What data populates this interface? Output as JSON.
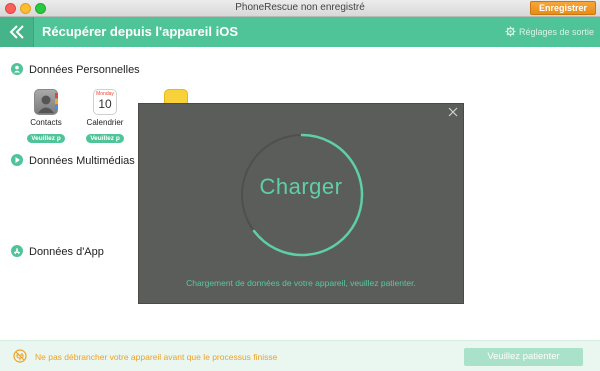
{
  "window": {
    "title": "PhoneRescue non enregistré",
    "register_label": "Enregistrer"
  },
  "header": {
    "title": "Récupérer depuis l'appareil iOS",
    "exit_settings_label": "Réglages de sortie"
  },
  "sections": {
    "personal": "Données Personnelles",
    "media": "Données Multimédias",
    "apps": "Données d'App"
  },
  "items": [
    {
      "label": "Contacts",
      "status": "Veuillez p",
      "icon": "contacts-icon"
    },
    {
      "label": "Calendrier",
      "status": "Veuillez p",
      "icon": "calendar-icon",
      "month": "Monday",
      "day": "10"
    },
    {
      "label": "",
      "status": "",
      "icon": "notes-icon"
    }
  ],
  "modal": {
    "title": "Charger",
    "message": "Chargement de données de votre appareil, veuillez patienter."
  },
  "footer": {
    "warning": "Ne pas débrancher votre appareil avant que le processus finisse",
    "wait_button": "Veuillez patienter"
  },
  "colors": {
    "accent": "#4fc498",
    "warning": "#f0a024",
    "modal_bg": "#5b5d5a"
  }
}
